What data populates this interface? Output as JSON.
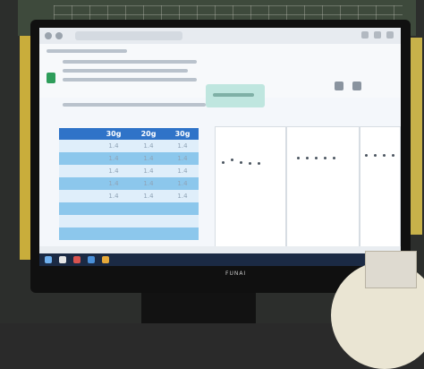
{
  "monitor": {
    "brand_text": "FUNAI"
  },
  "spreadsheet": {
    "columns": [
      "",
      "30g",
      "20g",
      "30g"
    ],
    "rows": [
      [
        "",
        "1.4",
        "1.4",
        "1.4"
      ],
      [
        "",
        "1.4",
        "1.4",
        "1.4"
      ],
      [
        "",
        "1.4",
        "1.4",
        "1.4"
      ],
      [
        "",
        "1.4",
        "1.4",
        "1.4"
      ],
      [
        "",
        "1.4",
        "1.4",
        "1.4"
      ],
      [
        "",
        "",
        "",
        ""
      ],
      [
        "",
        "",
        "",
        ""
      ],
      [
        "",
        "",
        "",
        ""
      ]
    ]
  }
}
